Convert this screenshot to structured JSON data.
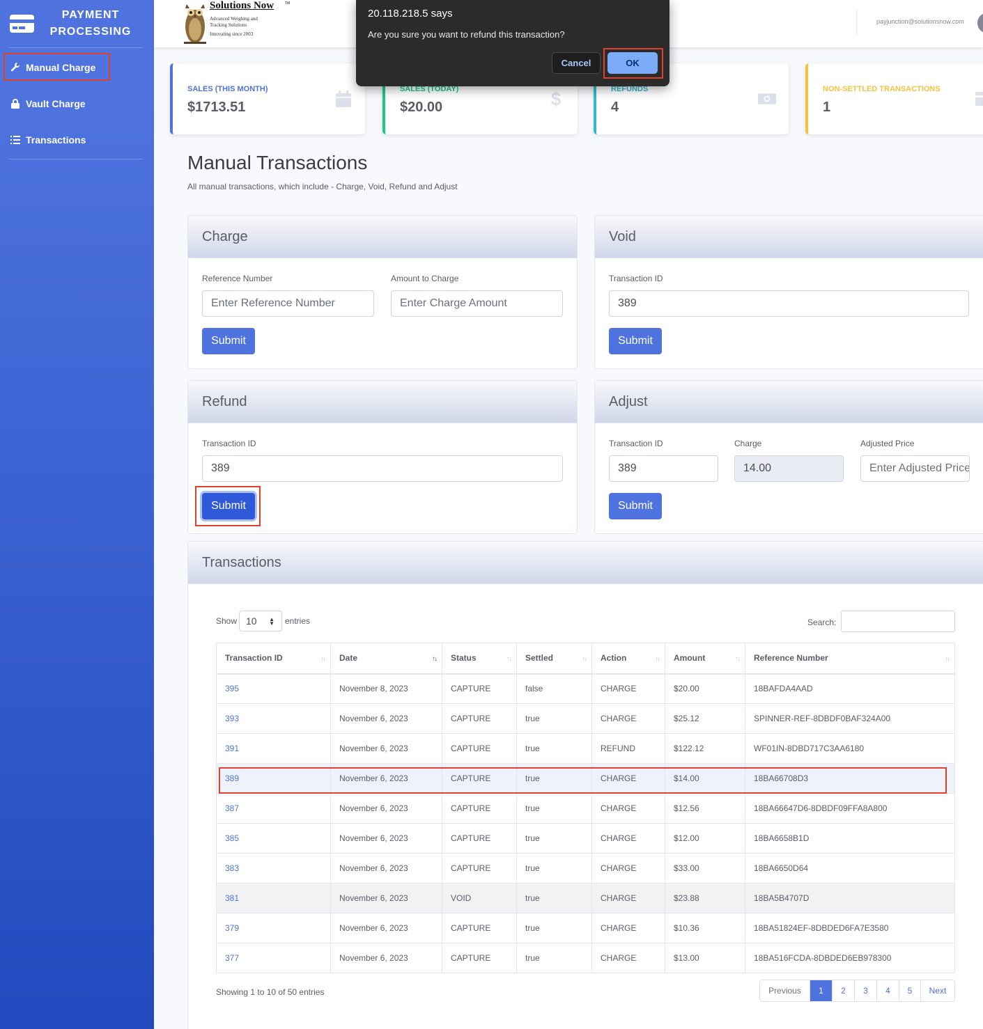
{
  "sidebar": {
    "brand_line1": "PAYMENT",
    "brand_line2": "PROCESSING",
    "items": [
      {
        "label": "Manual Charge",
        "icon": "wrench-icon"
      },
      {
        "label": "Vault Charge",
        "icon": "lock-icon"
      },
      {
        "label": "Transactions",
        "icon": "list-icon"
      }
    ]
  },
  "topbar": {
    "logo_title": "Solutions Now",
    "logo_tm": "TM",
    "logo_sub1": "Advanced Weighing and",
    "logo_sub2": "Tracking Solutions",
    "logo_sub3": "Innovating since 2003",
    "user_email": "payjunction@solutionsnow.com"
  },
  "stats": [
    {
      "label": "SALES (THIS MONTH)",
      "value": "$1713.51",
      "color": "#4e73df",
      "icon": "calendar-icon"
    },
    {
      "label": "SALES (TODAY)",
      "value": "$20.00",
      "color": "#1cc88a",
      "icon": "dollar-icon"
    },
    {
      "label": "REFUNDS",
      "value": "4",
      "color": "#36b9cc",
      "icon": "money-bill-icon"
    },
    {
      "label": "NON-SETTLED TRANSACTIONS",
      "value": "1",
      "color": "#f6c23e",
      "icon": "credit-card-icon"
    }
  ],
  "page": {
    "title": "Manual Transactions",
    "subtitle": "All manual transactions, which include - Charge, Void, Refund and Adjust"
  },
  "charge": {
    "title": "Charge",
    "ref_label": "Reference Number",
    "ref_placeholder": "Enter Reference Number",
    "amount_label": "Amount to Charge",
    "amount_placeholder": "Enter Charge Amount",
    "submit": "Submit"
  },
  "void": {
    "title": "Void",
    "tid_label": "Transaction ID",
    "tid_value": "389",
    "submit": "Submit"
  },
  "refund": {
    "title": "Refund",
    "tid_label": "Transaction ID",
    "tid_value": "389",
    "submit": "Submit"
  },
  "adjust": {
    "title": "Adjust",
    "tid_label": "Transaction ID",
    "tid_value": "389",
    "charge_label": "Charge",
    "charge_value": "14.00",
    "adjusted_label": "Adjusted Price",
    "adjusted_placeholder": "Enter Adjusted Price",
    "submit": "Submit"
  },
  "transactions": {
    "title": "Transactions",
    "show_label": "Show",
    "entries_value": "10",
    "entries_label": "entries",
    "search_label": "Search:",
    "columns": [
      "Transaction ID",
      "Date",
      "Status",
      "Settled",
      "Action",
      "Amount",
      "Reference Number"
    ],
    "rows": [
      [
        "395",
        "November 8, 2023",
        "CAPTURE",
        "false",
        "CHARGE",
        "$20.00",
        "18BAFDA4AAD"
      ],
      [
        "393",
        "November 6, 2023",
        "CAPTURE",
        "true",
        "CHARGE",
        "$25.12",
        "SPINNER-REF-8DBDF0BAF324A00"
      ],
      [
        "391",
        "November 6, 2023",
        "CAPTURE",
        "true",
        "REFUND",
        "$122.12",
        "WF01IN-8DBD717C3AA6180"
      ],
      [
        "389",
        "November 6, 2023",
        "CAPTURE",
        "true",
        "CHARGE",
        "$14.00",
        "18BA66708D3"
      ],
      [
        "387",
        "November 6, 2023",
        "CAPTURE",
        "true",
        "CHARGE",
        "$12.56",
        "18BA66647D6-8DBDF09FFA8A800"
      ],
      [
        "385",
        "November 6, 2023",
        "CAPTURE",
        "true",
        "CHARGE",
        "$12.00",
        "18BA6658B1D"
      ],
      [
        "383",
        "November 6, 2023",
        "CAPTURE",
        "true",
        "CHARGE",
        "$33.00",
        "18BA6650D64"
      ],
      [
        "381",
        "November 6, 2023",
        "VOID",
        "true",
        "CHARGE",
        "$23.88",
        "18BA5B4707D"
      ],
      [
        "379",
        "November 6, 2023",
        "CAPTURE",
        "true",
        "CHARGE",
        "$10.36",
        "18BA51824EF-8DBDED6FA7E3580"
      ],
      [
        "377",
        "November 6, 2023",
        "CAPTURE",
        "true",
        "CHARGE",
        "$13.00",
        "18BA516FCDA-8DBDED6EB978300"
      ]
    ],
    "showing": "Showing 1 to 10 of 50 entries",
    "pager": [
      "Previous",
      "1",
      "2",
      "3",
      "4",
      "5",
      "Next"
    ]
  },
  "dialog": {
    "title": "20.118.218.5 says",
    "message": "Are you sure you want to refund this transaction?",
    "cancel": "Cancel",
    "ok": "OK"
  }
}
